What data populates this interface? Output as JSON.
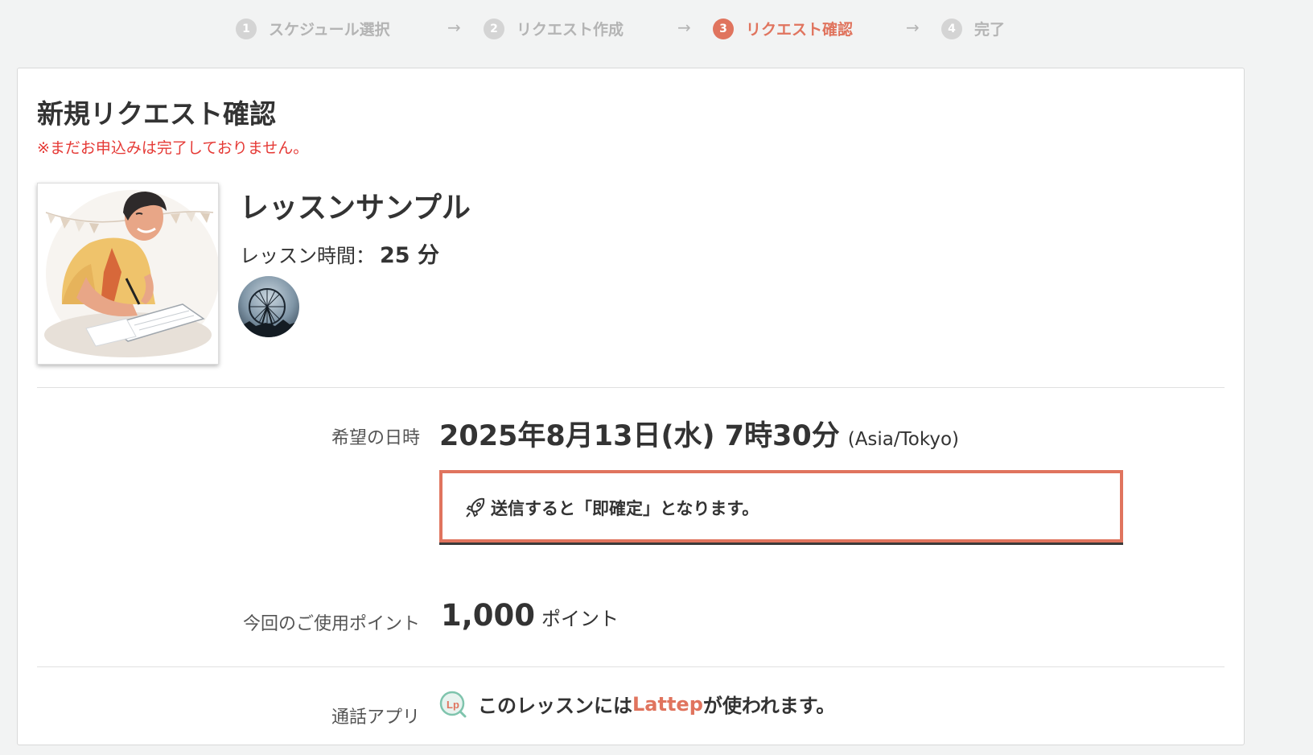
{
  "stepper": {
    "steps": [
      {
        "num": "1",
        "label": "スケジュール選択"
      },
      {
        "num": "2",
        "label": "リクエスト作成"
      },
      {
        "num": "3",
        "label": "リクエスト確認"
      },
      {
        "num": "4",
        "label": "完了"
      }
    ],
    "arrow": "→",
    "active_step": 3
  },
  "page": {
    "title": "新規リクエスト確認",
    "notice": "※まだお申込みは完了しておりません。"
  },
  "lesson": {
    "name": "レッスンサンプル",
    "duration_label": "レッスン時間：",
    "duration_value": "25 分"
  },
  "request": {
    "datetime_label": "希望の日時",
    "datetime_value": "2025年8月13日(水) 7時30分",
    "timezone": "(Asia/Tokyo)",
    "instant_message": "送信すると「即確定」となります。",
    "points_label": "今回のご使用ポイント",
    "points_value": "1,000",
    "points_unit": "ポイント",
    "app_label": "通話アプリ",
    "app_prefix": "このレッスンには",
    "app_name": "Lattep",
    "app_suffix": "が使われます。"
  },
  "colors": {
    "accent": "#e0745e",
    "warning": "#e53935",
    "inactive": "#b4b4b4"
  },
  "icons": {
    "instant": "rocket-icon",
    "app": "lattep-logo-icon"
  }
}
